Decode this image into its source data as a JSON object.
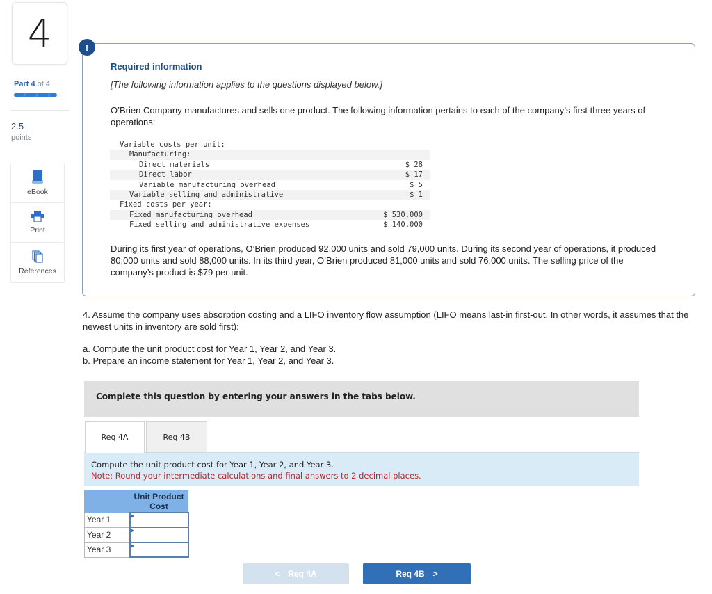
{
  "sidebar": {
    "question_number": "4",
    "part_prefix": "Part",
    "part_current": "4",
    "part_suffix": "of 4",
    "part_progress_fraction": 1.0,
    "points_value": "2.5",
    "points_label": "points",
    "tools": [
      {
        "label": "eBook",
        "icon": "book-icon"
      },
      {
        "label": "Print",
        "icon": "printer-icon"
      },
      {
        "label": "References",
        "icon": "documents-icon"
      }
    ]
  },
  "required_info": {
    "badge": "!",
    "title": "Required information",
    "subtitle": "[The following information applies to the questions displayed below.]",
    "intro": "O’Brien Company manufactures and sells one product. The following information pertains to each of the company’s first three years of operations:",
    "cost_table": [
      {
        "label": "Variable costs per unit:",
        "value": ""
      },
      {
        "label": "Manufacturing:",
        "value": ""
      },
      {
        "label": "Direct materials",
        "value": "$ 28"
      },
      {
        "label": "Direct labor",
        "value": "$ 17"
      },
      {
        "label": "Variable manufacturing overhead",
        "value": "$ 5"
      },
      {
        "label": "Variable selling and administrative",
        "value": "$ 1"
      },
      {
        "label": "Fixed costs per year:",
        "value": ""
      },
      {
        "label": "Fixed manufacturing overhead",
        "value": "$ 530,000"
      },
      {
        "label": "Fixed selling and administrative expenses",
        "value": "$ 140,000"
      }
    ],
    "story": "During its first year of operations, O’Brien produced 92,000 units and sold 79,000 units. During its second year of operations, it produced 80,000 units and sold 88,000 units. In its third year, O’Brien produced 81,000 units and sold 76,000 units. The selling price of the company’s product is $79 per unit."
  },
  "question": {
    "text": "4. Assume the company uses absorption costing and a LIFO inventory flow assumption (LIFO means last-in first-out. In other words, it assumes that the newest units in inventory are sold first):",
    "part_a": "a. Compute the unit product cost for Year 1, Year 2, and Year 3.",
    "part_b": "b. Prepare an income statement for Year 1, Year 2, and Year 3."
  },
  "answer": {
    "complete_text": "Complete this question by entering your answers in the tabs below.",
    "tabs": [
      {
        "label": "Req 4A",
        "active": true
      },
      {
        "label": "Req 4B",
        "active": false
      }
    ],
    "instruction": "Compute the unit product cost for Year 1, Year 2, and Year 3.",
    "note": "Note: Round your intermediate calculations and final answers to 2 decimal places.",
    "table": {
      "column_header_line1": "Unit Product",
      "column_header_line2": "Cost",
      "rows": [
        {
          "label": "Year 1",
          "value": ""
        },
        {
          "label": "Year 2",
          "value": ""
        },
        {
          "label": "Year 3",
          "value": ""
        }
      ]
    },
    "prev_button": "Req 4A",
    "next_button": "Req 4B",
    "prev_chevron": "<",
    "next_chevron": ">"
  }
}
